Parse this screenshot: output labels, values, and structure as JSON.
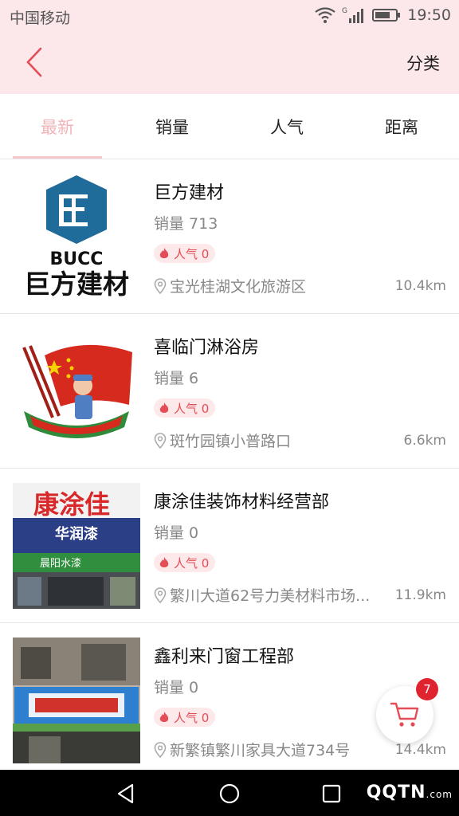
{
  "status_bar": {
    "carrier": "中国移动",
    "time": "19:50",
    "network": "G"
  },
  "header": {
    "category_label": "分类"
  },
  "tabs": [
    {
      "label": "最新",
      "active": true
    },
    {
      "label": "销量",
      "active": false
    },
    {
      "label": "人气",
      "active": false
    },
    {
      "label": "距离",
      "active": false
    }
  ],
  "stores": [
    {
      "name": "巨方建材",
      "sales": "销量 713",
      "popularity": "人气 0",
      "address": "宝光桂湖文化旅游区",
      "distance": "10.4km",
      "logo": {
        "brand_en": "BUCC",
        "brand_cn": "巨方建材"
      }
    },
    {
      "name": "喜临门淋浴房",
      "sales": "销量 6",
      "popularity": "人气 0",
      "address": "斑竹园镇小普路口",
      "distance": "6.6km"
    },
    {
      "name": "康涂佳装饰材料经营部",
      "sales": "销量 0",
      "popularity": "人气 0",
      "address": "繁川大道62号力美材料市场...",
      "distance": "11.9km",
      "photo": {
        "top_sign": "康涂佳",
        "mid_sign": "华润漆",
        "low_sign": "晨阳水漆"
      }
    },
    {
      "name": "鑫利来门窗工程部",
      "sales": "销量 0",
      "popularity": "人气 0",
      "address": "新繁镇繁川家具大道734号",
      "distance": "14.4km"
    }
  ],
  "cart": {
    "count": "7"
  },
  "watermark": {
    "text": "QQTN",
    "suffix": ".com"
  },
  "colors": {
    "header_bg": "#fce8ea",
    "accent": "#e44d56",
    "tab_active": "#f3b4b8",
    "badge_red": "#e0242f"
  },
  "icons": {
    "back": "chevron-left-icon",
    "fire": "fire-icon",
    "location": "location-pin-icon",
    "cart": "cart-icon"
  }
}
